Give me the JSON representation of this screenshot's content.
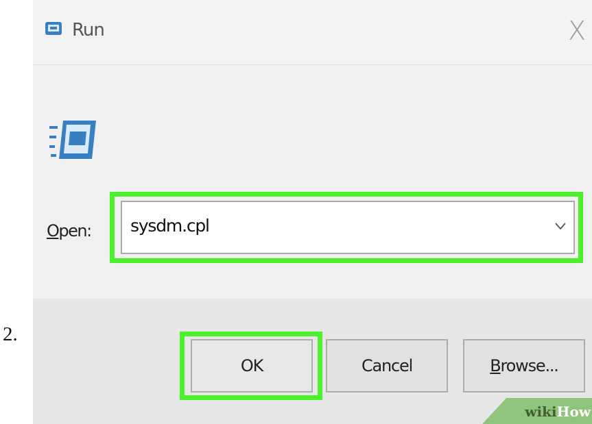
{
  "step": {
    "number": "2."
  },
  "dialog": {
    "title": "Run",
    "close_glyph": "X",
    "title_icon": "run-icon",
    "large_icon": "run-icon",
    "open_label_mnemonic": "O",
    "open_label_rest": "pen:",
    "open_input": {
      "value": "sysdm.cpl",
      "dropdown_icon": "chevron-down-icon"
    },
    "buttons": {
      "ok": "OK",
      "cancel": "Cancel",
      "browse_mnemonic": "B",
      "browse_rest": "rowse..."
    }
  },
  "highlight_color": "#4cf02c",
  "watermark": {
    "part1": "wiki",
    "part2": "How"
  }
}
